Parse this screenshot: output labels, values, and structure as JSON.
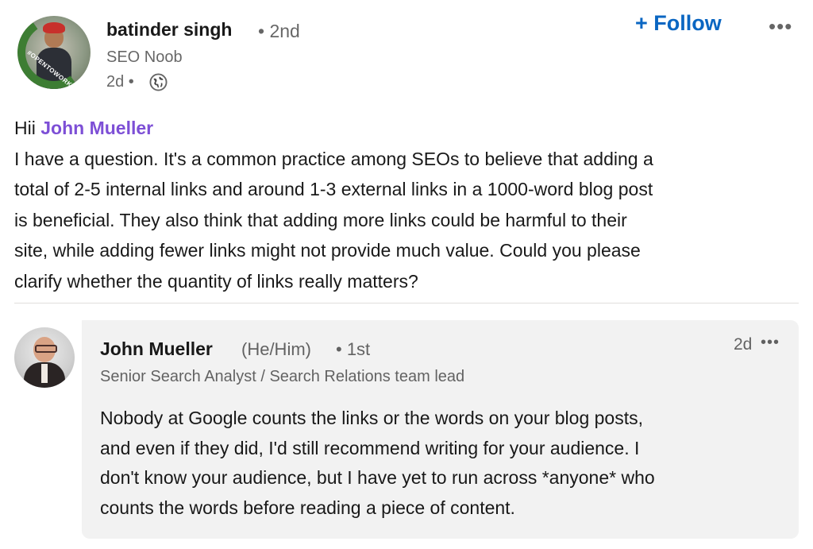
{
  "post": {
    "author": {
      "name": "batinder singh",
      "degree": "• 2nd",
      "headline": "SEO Noob",
      "time": "2d •",
      "avatar_badge": "#OPENTOWORK"
    },
    "follow_label": "+ Follow",
    "more_label": "•••",
    "greeting": "Hii",
    "mention": "John Mueller",
    "body_lines": [
      "I have a question. It's a common practice among SEOs to believe that adding a",
      "total of 2-5 internal links and around 1-3 external links in a 1000-word blog post",
      "is beneficial. They also think that adding more links could be harmful to their",
      "site, while adding fewer links might not provide much value. Could you please",
      "clarify whether the quantity of links really matters?"
    ]
  },
  "comment": {
    "name": "John Mueller",
    "pronouns": "(He/Him)",
    "degree": "• 1st",
    "headline": "Senior Search Analyst / Search Relations team lead",
    "time": "2d",
    "more_label": "•••",
    "body_lines": [
      "Nobody at Google counts the links or the words on your blog posts,",
      "and even if they did, I'd still recommend writing for your audience. I",
      "don't know your audience, but I have yet to run across *anyone* who",
      "counts the words before reading a piece of content."
    ]
  },
  "colors": {
    "accent": "#0a66c2",
    "mention": "#7d4fd6",
    "bubble": "#f2f2f2"
  },
  "icons": {
    "visibility": "globe-icon",
    "menu": "more-icon"
  }
}
